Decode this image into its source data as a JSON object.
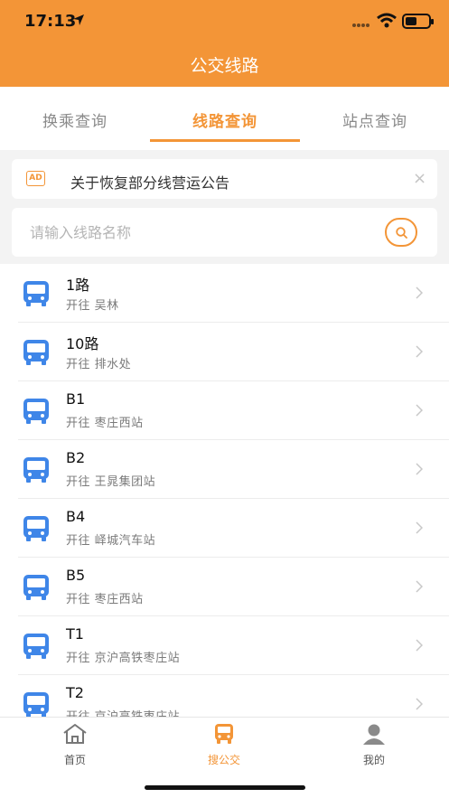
{
  "status": {
    "time": "17:13"
  },
  "header": {
    "title": "公交线路"
  },
  "tabs": [
    {
      "label": "换乘查询"
    },
    {
      "label": "线路查询"
    },
    {
      "label": "站点查询"
    }
  ],
  "notice": {
    "badge": "AD",
    "text": "关于恢复部分线营运公告",
    "close": "×"
  },
  "search": {
    "placeholder": "请输入线路名称"
  },
  "routes": [
    {
      "name": "1路",
      "dest": "开往 吴林"
    },
    {
      "name": "10路",
      "dest": "开往 排水处"
    },
    {
      "name": "B1",
      "dest": "开往 枣庄西站"
    },
    {
      "name": "B2",
      "dest": "开往 王晁集团站"
    },
    {
      "name": "B4",
      "dest": "开往 峄城汽车站"
    },
    {
      "name": "B5",
      "dest": "开往 枣庄西站"
    },
    {
      "name": "T1",
      "dest": "开往 京沪高铁枣庄站"
    },
    {
      "name": "T2",
      "dest": "开往 京沪高铁枣庄站"
    }
  ],
  "tabbar": [
    {
      "label": "首页",
      "icon": "home-icon"
    },
    {
      "label": "搜公交",
      "icon": "bus-icon"
    },
    {
      "label": "我的",
      "icon": "user-icon"
    }
  ],
  "colors": {
    "accent": "#f39537",
    "bus_icon": "#3f86e8"
  }
}
